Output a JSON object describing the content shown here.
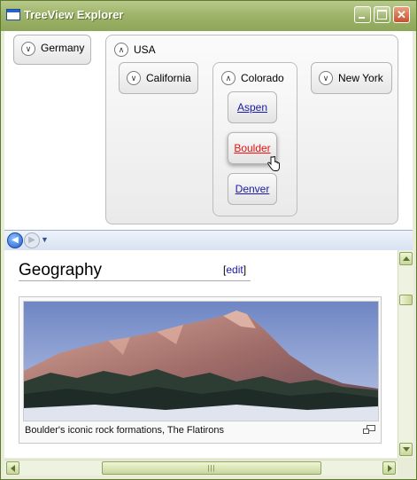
{
  "window": {
    "title": "TreeView Explorer",
    "accent_color": "#8ea659"
  },
  "tree": {
    "collapsed_icon": "chevron-down-icon",
    "expanded_icon": "chevron-up-icon",
    "nodes": {
      "germany": {
        "label": "Germany",
        "expanded": false
      },
      "usa": {
        "label": "USA",
        "expanded": true,
        "children": {
          "california": {
            "label": "California",
            "expanded": false
          },
          "colorado": {
            "label": "Colorado",
            "expanded": true,
            "cities": [
              {
                "label": "Aspen"
              },
              {
                "label": "Boulder",
                "hovered": true
              },
              {
                "label": "Denver"
              }
            ]
          },
          "new_york": {
            "label": "New York",
            "expanded": false
          }
        }
      }
    }
  },
  "browser": {
    "back_icon": "back-arrow-icon",
    "forward_icon": "forward-arrow-icon"
  },
  "article": {
    "section_title": "Geography",
    "edit_open": "[",
    "edit_label": "edit",
    "edit_close": "]",
    "image_caption": "Boulder's iconic rock formations, The Flatirons",
    "enlarge_icon": "enlarge-icon"
  }
}
